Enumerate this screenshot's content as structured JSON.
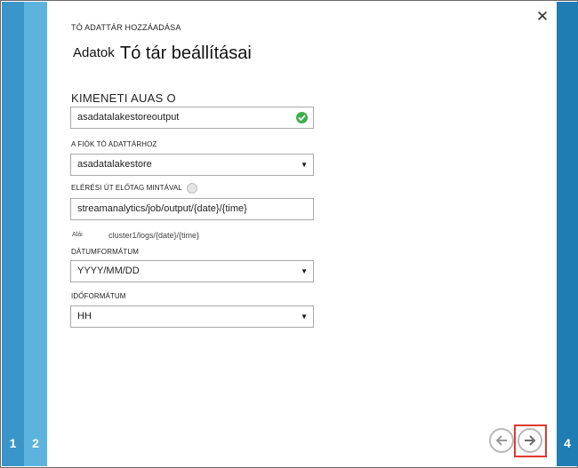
{
  "wizard": {
    "title": "TÓ ADATTÁR HOZZÁADÁSA",
    "heading_prefix": "Adatok",
    "heading": "Tó tár beállításai"
  },
  "steps": [
    "1",
    "2",
    "4"
  ],
  "fields": {
    "output_alias": {
      "label": "KIMENETI AUAS O",
      "value": "asadatalakestoreoutput",
      "status_icon": "check-circle-icon",
      "status_color": "#3cae49"
    },
    "account": {
      "label": "A FIÓK TÓ ADATTÁRHOZ",
      "value": "asadatalakestore"
    },
    "path_prefix": {
      "label": "ELÉRÉSI ÚT ELŐTAG MINTÁVAL",
      "value": "streamanalytics/job/output/{date}/{time}",
      "example_prefix": "Alái",
      "example_value": "cluster1/logs/{date}/{time}"
    },
    "date_format": {
      "label": "DÁTUMFORMÁTUM",
      "value": "YYYY/MM/DD"
    },
    "time_format": {
      "label": "IDŐFORMÁTUM",
      "value": "HH"
    }
  },
  "icons": {
    "close": "close-icon",
    "previous": "arrow-left-icon",
    "next": "arrow-right-icon",
    "info": "info-icon",
    "dropdown": "chevron-down-icon"
  },
  "colors": {
    "step1": "#3a96c8",
    "step2": "#5bb3de",
    "step4": "#1f7db4",
    "highlight": "#e03a2f"
  },
  "glyphs": {
    "close": "✕",
    "dropdown": "▼"
  }
}
